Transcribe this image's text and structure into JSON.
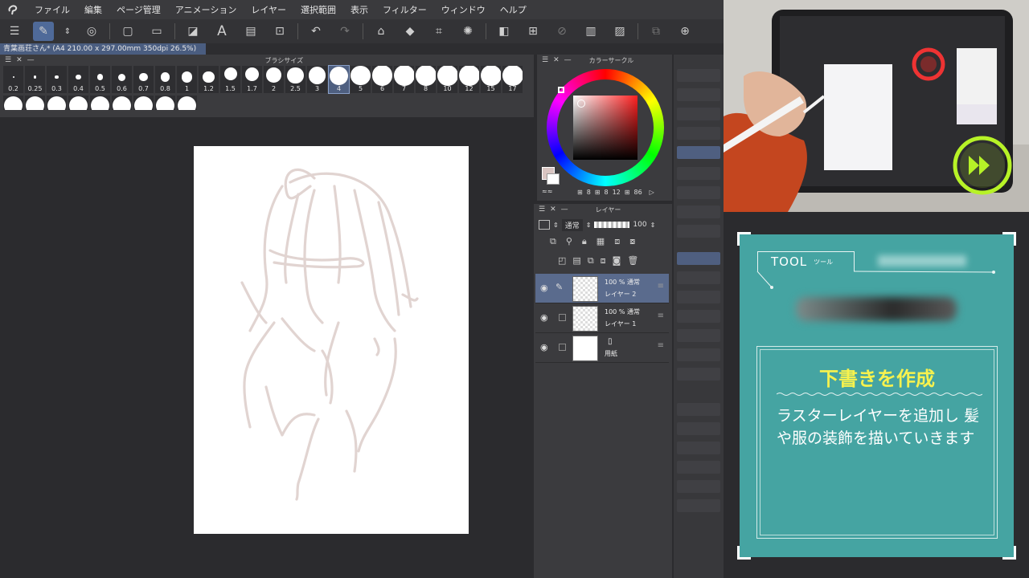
{
  "menu": [
    "ファイル",
    "編集",
    "ページ管理",
    "アニメーション",
    "レイヤー",
    "選択範囲",
    "表示",
    "フィルター",
    "ウィンドウ",
    "ヘルプ"
  ],
  "document_tab": "青葉画荘さん* (A4 210.00 x 297.00mm 350dpi 26.5%)",
  "brush_panel": {
    "title": "ブラシサイズ",
    "sizes": [
      "0.2",
      "0.25",
      "0.3",
      "0.4",
      "0.5",
      "0.6",
      "0.7",
      "0.8",
      "1",
      "1.2",
      "1.5",
      "1.7",
      "2",
      "2.5",
      "3",
      "4",
      "5",
      "6",
      "7",
      "8",
      "10",
      "12",
      "15",
      "17"
    ],
    "selected": "4"
  },
  "color_panel": {
    "title": "カラーサークル",
    "h": "8",
    "s": "8",
    "v": "12",
    "extra": "86"
  },
  "layer_panel": {
    "title": "レイヤー",
    "blend": "通常",
    "opacity": "100",
    "layers": [
      {
        "opacity_mode": "100 % 通常",
        "name": "レイヤー 2",
        "selected": true
      },
      {
        "opacity_mode": "100 % 通常",
        "name": "レイヤー 1",
        "selected": false
      },
      {
        "opacity_mode": "",
        "name": "用紙",
        "selected": false
      }
    ]
  },
  "info_card": {
    "tool_label": "TOOL",
    "tool_sub": "ツール",
    "title": "下書きを作成",
    "body": "ラスターレイヤーを追加し 髪や服の装飾を描いていきます"
  },
  "colors": {
    "accent_teal": "#45a4a2",
    "title_yellow": "#f7f24e",
    "ff_green": "#b7f227",
    "sketch": "#d9c9c6"
  }
}
